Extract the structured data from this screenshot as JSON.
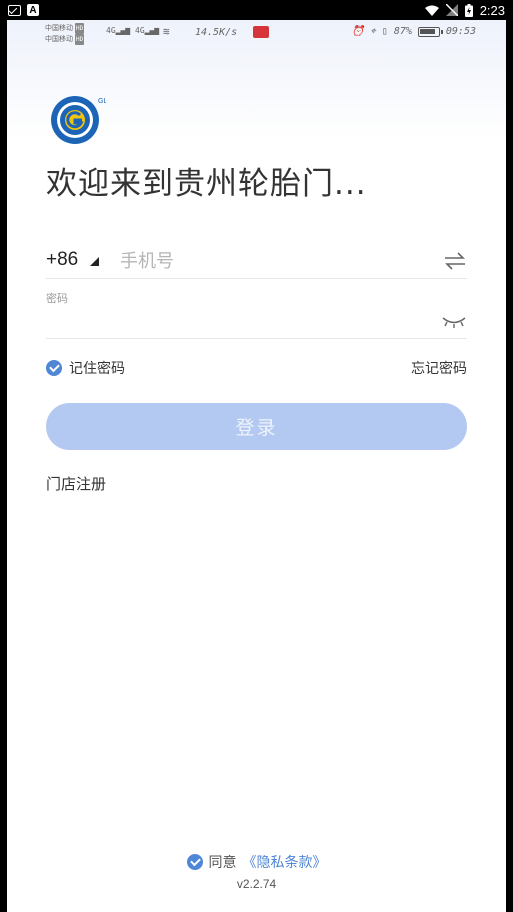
{
  "device_status": {
    "time": "2:23"
  },
  "inner_status": {
    "carrier1": "中国移动",
    "carrier2": "中国移动",
    "hd": "HD",
    "net": "4G",
    "speed": "14.5K/s",
    "battery_pct": "87%",
    "time": "09:53"
  },
  "login": {
    "title": "欢迎来到贵州轮胎门...",
    "country_code": "+86",
    "phone_placeholder": "手机号",
    "password_label": "密码",
    "remember_label": "记住密码",
    "forgot_label": "忘记密码",
    "login_button": "登录",
    "register_link": "门店注册",
    "agree_text": "同意",
    "privacy_link": "《隐私条款》",
    "version": "v2.2.74"
  },
  "colors": {
    "accent": "#4f86d6",
    "button_disabled": "#b3c9f1",
    "logo_blue": "#1c64b5",
    "logo_yellow": "#f1c40f"
  },
  "icons": {
    "swap": "swap-arrows-icon",
    "eye": "eye-closed-icon",
    "check": "check-circle-icon"
  }
}
